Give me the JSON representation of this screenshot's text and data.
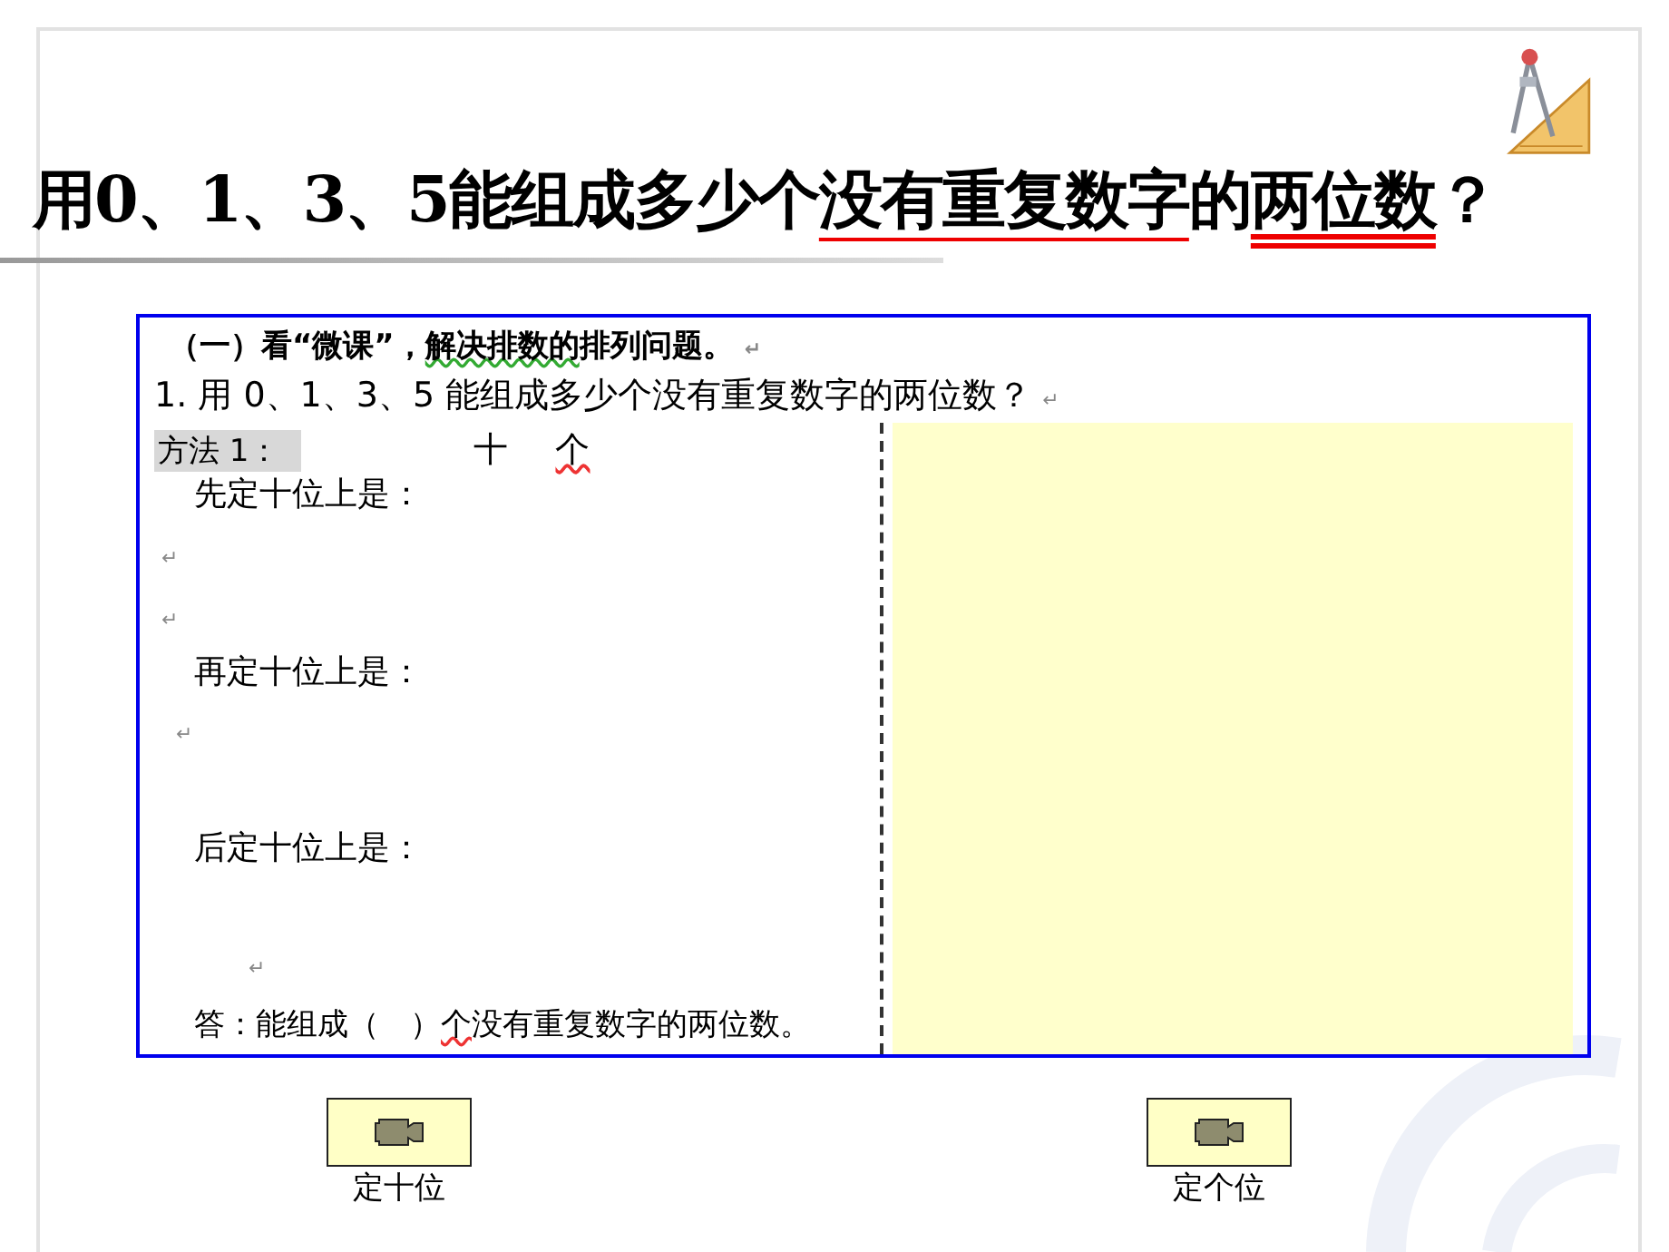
{
  "title": {
    "segments": [
      {
        "text": "用0、1、3、5能组成多少个",
        "kind": "plain"
      },
      {
        "text": "没有重复数字",
        "kind": "underlined"
      },
      {
        "text": "的",
        "kind": "plain"
      },
      {
        "text": "两位数",
        "kind": "double-underlined"
      },
      {
        "text": "？",
        "kind": "plain"
      }
    ]
  },
  "document": {
    "heading": {
      "segments": [
        {
          "text": "（一）看“微课”，",
          "grammar_mark": false
        },
        {
          "text": "解决排数的",
          "grammar_mark": true
        },
        {
          "text": "排列问题。",
          "grammar_mark": false
        }
      ],
      "return_mark": "↵"
    },
    "question": {
      "text": "1. 用 0、1、3、5 能组成多少个没有重复数字的两位数？",
      "return_mark": "↵"
    },
    "method": {
      "label": "方法 1：",
      "columns": [
        {
          "text": "十",
          "spelling_mark": false
        },
        {
          "text": "个",
          "spelling_mark": true
        }
      ]
    },
    "lines": [
      {
        "kind": "step",
        "text": "先定十位上是："
      },
      {
        "kind": "return",
        "text": "↵"
      },
      {
        "kind": "return",
        "text": "↵"
      },
      {
        "kind": "step",
        "text": "再定十位上是："
      },
      {
        "kind": "return",
        "text": "↵"
      },
      {
        "kind": "step",
        "text": "后定十位上是："
      },
      {
        "kind": "return",
        "text": "↵"
      },
      {
        "kind": "answer",
        "segments": [
          {
            "text": "答：能组成（　）",
            "spelling_mark": false
          },
          {
            "text": "个",
            "spelling_mark": true
          },
          {
            "text": "没有重复数字的两位数。",
            "spelling_mark": false
          }
        ]
      }
    ]
  },
  "video_buttons": [
    {
      "label": "定十位"
    },
    {
      "label": "定个位"
    }
  ]
}
